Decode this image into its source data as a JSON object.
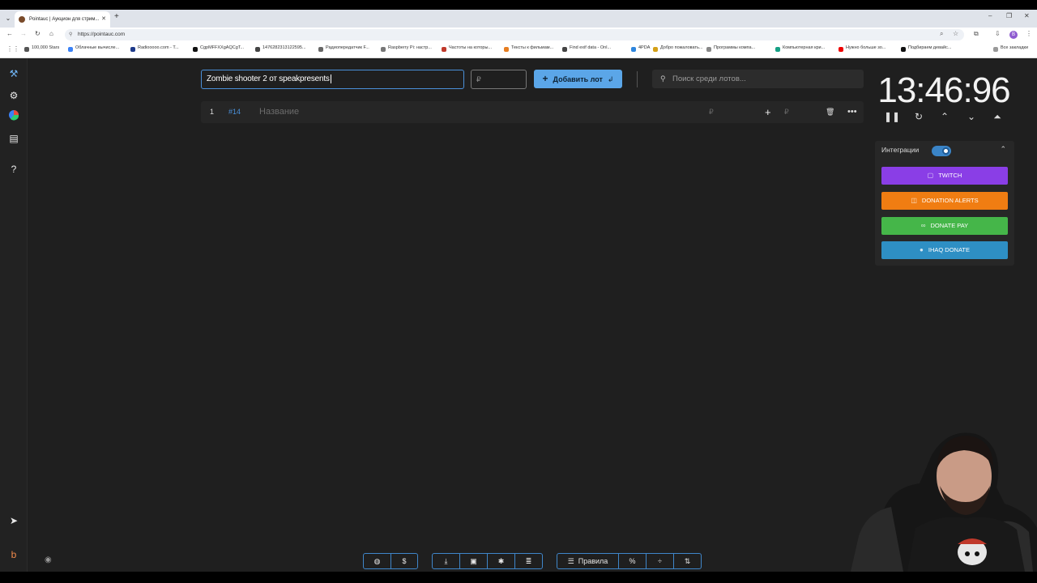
{
  "browser": {
    "tab_title": "Pointauc | Аукцион для стрим...",
    "url": "https://pointauc.com",
    "profile_initial": "B",
    "bookmarks": [
      {
        "label": "100,000 Stars",
        "color": "#555"
      },
      {
        "label": "Облачные вычисле...",
        "color": "#3b82f6"
      },
      {
        "label": "Radiooooo.com - T...",
        "color": "#1e3a8a"
      },
      {
        "label": "CgpMFFXXgAQCgT...",
        "color": "#111"
      },
      {
        "label": "1476282313122595...",
        "color": "#444"
      },
      {
        "label": "Радиопередатчик F...",
        "color": "#666"
      },
      {
        "label": "Raspberry Pi: настр...",
        "color": "#777"
      },
      {
        "label": "Частоты на которы...",
        "color": "#c0392b"
      },
      {
        "label": "Тексты к фильмам...",
        "color": "#e67e22"
      },
      {
        "label": "Find exif data - Onl...",
        "color": "#444"
      },
      {
        "label": "4PDA",
        "color": "#2e86de"
      },
      {
        "label": "Добро пожаловать...",
        "color": "#d4a017"
      },
      {
        "label": "Программы компа...",
        "color": "#888"
      },
      {
        "label": "Компьютерная кри...",
        "color": "#16a085"
      },
      {
        "label": "Нужно больше зо...",
        "color": "#e00"
      },
      {
        "label": "Подбираем девайс...",
        "color": "#111"
      }
    ],
    "all_bookmarks": "Все закладки"
  },
  "app": {
    "lot_name_value": "Zombie shooter 2 от speakpresents",
    "amount_placeholder": "₽",
    "add_button_label": "Добавить лот",
    "search_placeholder": "Поиск среди лотов...",
    "lot_row": {
      "index": "1",
      "id": "#14",
      "name_placeholder": "Название",
      "currency": "₽",
      "add_currency": "₽"
    },
    "timer": "13:46:96",
    "integrations": {
      "title": "Интеграции",
      "enabled": true,
      "buttons": [
        {
          "label": "TWITCH",
          "color": "#8a3ee6"
        },
        {
          "label": "DONATION ALERTS",
          "color": "#f07d12"
        },
        {
          "label": "DONATE PAY",
          "color": "#45b649"
        },
        {
          "label": "IHAQ DONATE",
          "color": "#2e8fc4"
        }
      ]
    },
    "footer": {
      "rules_label": "Правила",
      "percent_label": "%"
    }
  }
}
